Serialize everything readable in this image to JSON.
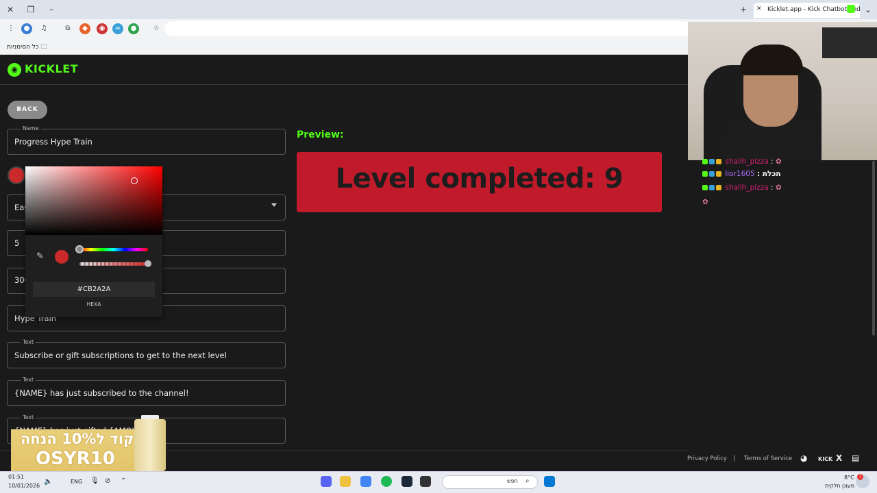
{
  "browser": {
    "tab_title": "Kicklet.app - Kick Chatbot and",
    "bookmarks_label": "כל הסימניות"
  },
  "app": {
    "logo": "KICKLET",
    "back_label": "BACK",
    "fields": [
      {
        "label": "Name",
        "value": "Progress Hype Train"
      },
      {
        "label": "",
        "value": "Eas"
      },
      {
        "label": "",
        "value": "5"
      },
      {
        "label": "",
        "value": "300"
      },
      {
        "label": "",
        "value": "Hype Train"
      },
      {
        "label": "Text",
        "value": "Subscribe or gift subscriptions to get to the next level"
      },
      {
        "label": "Text",
        "value": "{NAME} has just subscribed to the channel!"
      },
      {
        "label": "Text",
        "value": "{NAME} has just gifted {AMOUNT} S"
      }
    ],
    "color_picker": {
      "hex": "#CB2A2A",
      "mode": "HEXA",
      "color": "#cb2a2a"
    },
    "preview": {
      "title": "Preview:",
      "text": "Level completed: 9",
      "bg_color": "#c01a2b"
    },
    "footer": {
      "privacy": "Privacy Policy",
      "separator": "|",
      "terms": "Terms of Service",
      "kick_label": "KICK",
      "x_label": "X"
    }
  },
  "promo": {
    "line1": "קוד ל10% הנחה",
    "line2": "OSYR10"
  },
  "chat": {
    "messages": [
      {
        "user": "shalih_pizza",
        "text": ":",
        "user_color": "#e0207a"
      },
      {
        "user": "lior1605",
        "text": ": תכלת",
        "user_color": "#b06cff"
      },
      {
        "user": "shalih_pizza",
        "text": ":",
        "user_color": "#e0207a"
      }
    ]
  },
  "taskbar": {
    "time": "01:51",
    "date": "10/01/2026",
    "lang": "ENG",
    "search_placeholder": "חפש",
    "weather_temp": "8°C",
    "weather_desc": "מעונן חלקית",
    "notif_count": "7"
  }
}
